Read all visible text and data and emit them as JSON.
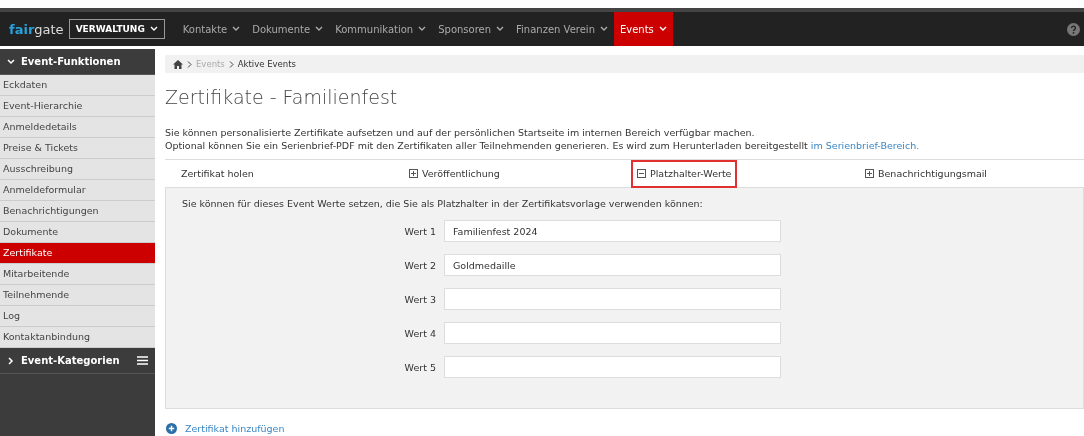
{
  "topbar": {
    "logo_part1": "fair",
    "logo_part2": "gate",
    "mode_select": "VERWALTUNG",
    "menu": [
      {
        "label": "Kontakte",
        "selected": false
      },
      {
        "label": "Dokumente",
        "selected": false
      },
      {
        "label": "Kommunikation",
        "selected": false
      },
      {
        "label": "Sponsoren",
        "selected": false
      },
      {
        "label": "Finanzen Verein",
        "selected": false
      },
      {
        "label": "Events",
        "selected": true
      }
    ]
  },
  "sidebar": {
    "sections": [
      {
        "title": "Event-Funktionen",
        "expanded": true,
        "items": [
          {
            "label": "Eckdaten",
            "selected": false
          },
          {
            "label": "Event-Hierarchie",
            "selected": false
          },
          {
            "label": "Anmeldedetails",
            "selected": false
          },
          {
            "label": "Preise & Tickets",
            "selected": false
          },
          {
            "label": "Ausschreibung",
            "selected": false
          },
          {
            "label": "Anmeldeformular",
            "selected": false
          },
          {
            "label": "Benachrichtigungen",
            "selected": false
          },
          {
            "label": "Dokumente",
            "selected": false
          },
          {
            "label": "Zertifikate",
            "selected": true
          },
          {
            "label": "Mitarbeitende",
            "selected": false
          },
          {
            "label": "Teilnehmende",
            "selected": false
          },
          {
            "label": "Log",
            "selected": false
          },
          {
            "label": "Kontaktanbindung",
            "selected": false
          }
        ]
      },
      {
        "title": "Event-Kategorien",
        "expanded": false
      }
    ]
  },
  "breadcrumb": [
    "Events",
    "Aktive Events"
  ],
  "title": "Zertifikate - Familienfest",
  "description_line1": "Sie können personalisierte Zertifikate aufsetzen und auf der persönlichen Startseite im internen Bereich verfügbar machen.",
  "description_line2": "Optional können Sie ein Serienbrief-PDF mit den Zertifikaten aller Teilnehmenden generieren. Es wird zum Herunterladen bereitgestellt",
  "description_link": "im Serienbrief-Bereich.",
  "sections": [
    {
      "label": "Zertifikat holen",
      "kind": "plain",
      "highlighted": false
    },
    {
      "label": "Veröffentlichung",
      "kind": "toggle",
      "expanded": false,
      "highlighted": false
    },
    {
      "label": "Platzhalter-Werte",
      "kind": "toggle",
      "expanded": true,
      "highlighted": true
    },
    {
      "label": "Benachrichtigungsmail",
      "kind": "toggle",
      "expanded": false,
      "highlighted": false
    }
  ],
  "panel": {
    "intro": "Sie können für dieses Event Werte setzen, die Sie als Platzhalter in der Zertifikatsvorlage verwenden können:",
    "fields": [
      {
        "label": "Wert 1",
        "value": "Familienfest 2024"
      },
      {
        "label": "Wert 2",
        "value": "Goldmedaille"
      },
      {
        "label": "Wert 3"
      },
      {
        "label": "Wert 4"
      },
      {
        "label": "Wert 5"
      }
    ]
  },
  "add_link": "Zertifikat hinzufügen"
}
